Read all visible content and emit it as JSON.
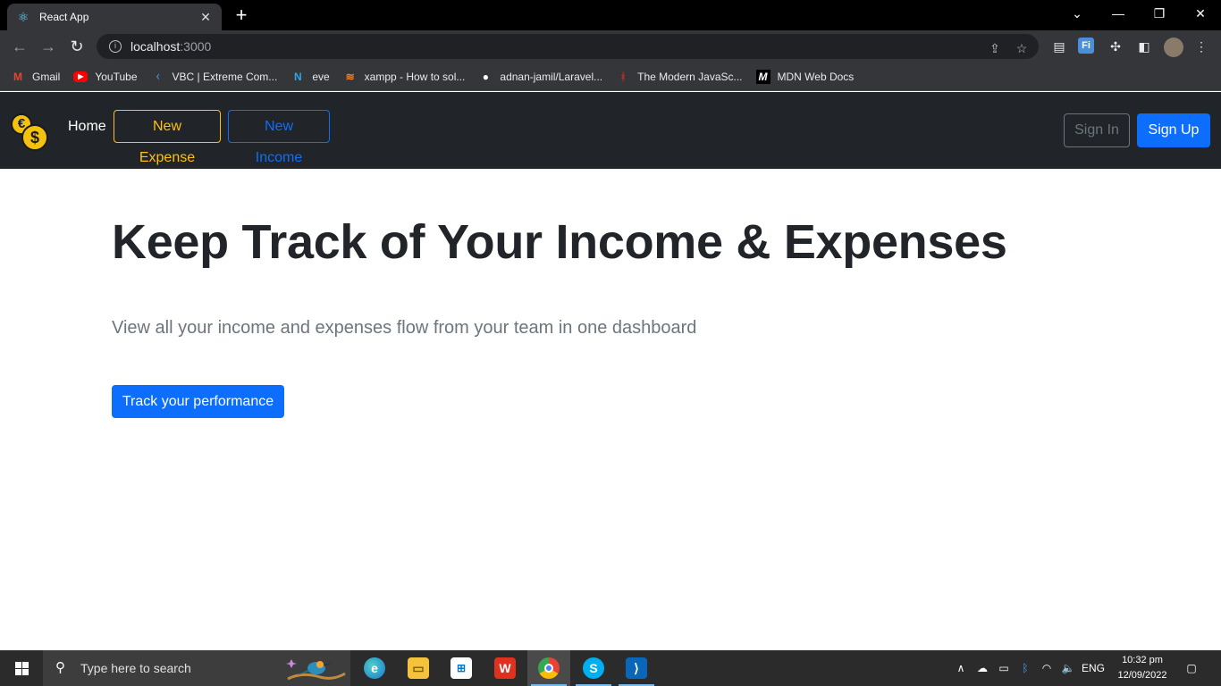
{
  "browser": {
    "tab_title": "React App",
    "url_host": "localhost",
    "url_port": ":3000",
    "bookmarks": [
      {
        "label": "Gmail",
        "icon": "gmail-icon"
      },
      {
        "label": "YouTube",
        "icon": "youtube-icon"
      },
      {
        "label": "VBC | Extreme Com...",
        "icon": "vbc-icon"
      },
      {
        "label": "eve",
        "icon": "eve-icon"
      },
      {
        "label": "xampp - How to sol...",
        "icon": "stackoverflow-icon"
      },
      {
        "label": "adnan-jamil/Laravel...",
        "icon": "github-icon"
      },
      {
        "label": "The Modern JavaSc...",
        "icon": "javascript-info-icon"
      },
      {
        "label": "MDN Web Docs",
        "icon": "mdn-icon"
      }
    ]
  },
  "app_nav": {
    "home": "Home",
    "new_expense": "New Expense",
    "new_income": "New Income",
    "sign_in": "Sign In",
    "sign_up": "Sign Up"
  },
  "hero": {
    "title": "Keep Track of Your Income & Expenses",
    "lead": "View all your income and expenses flow from your team in one dashboard",
    "cta": "Track your performance"
  },
  "taskbar": {
    "search_placeholder": "Type here to search",
    "language": "ENG",
    "time": "10:32 pm",
    "date": "12/09/2022"
  },
  "colors": {
    "navbar_bg": "#212529",
    "primary": "#0d6efd",
    "warning": "#ffc107",
    "secondary": "#6c757d"
  }
}
